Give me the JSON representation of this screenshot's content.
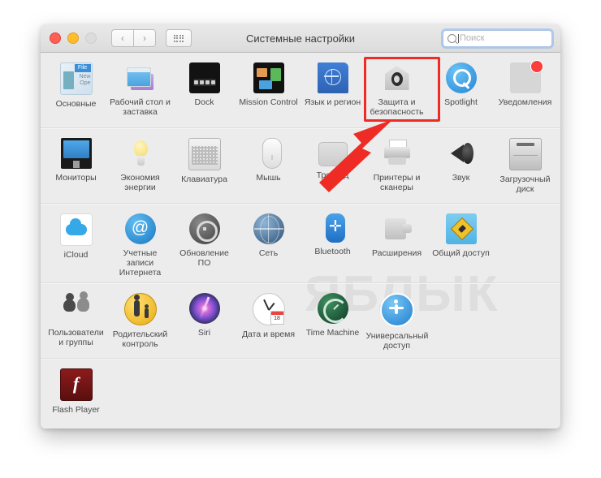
{
  "window": {
    "title": "Системные настройки",
    "traffic_lights": [
      "close-button",
      "minimize-button",
      "zoom-button"
    ],
    "nav": {
      "back": "‹",
      "forward": "›",
      "grid": "grid-view-icon"
    },
    "search": {
      "value": "",
      "placeholder": "Поиск"
    }
  },
  "watermark": "ЯБЛЫК",
  "highlight": {
    "color": "#ee2b24",
    "target": "Защита и безопасность"
  },
  "rows": [
    {
      "items": [
        {
          "label": "Основные",
          "icon": "general-icon",
          "icon_class": "i-general"
        },
        {
          "label": "Рабочий стол и заставка",
          "icon": "desktop-screensaver-icon",
          "icon_class": "i-desktop"
        },
        {
          "label": "Dock",
          "icon": "dock-icon",
          "icon_class": "i-dock"
        },
        {
          "label": "Mission Control",
          "icon": "mission-control-icon",
          "icon_class": "i-mission"
        },
        {
          "label": "Язык и регион",
          "icon": "language-region-icon",
          "icon_class": "i-lang"
        },
        {
          "label": "Защита и безопасность",
          "icon": "security-privacy-icon",
          "icon_class": "i-security"
        },
        {
          "label": "Spotlight",
          "icon": "spotlight-icon",
          "icon_class": "i-spotlight"
        },
        {
          "label": "Уведомления",
          "icon": "notifications-icon",
          "icon_class": "i-notif"
        }
      ]
    },
    {
      "items": [
        {
          "label": "Мониторы",
          "icon": "displays-icon",
          "icon_class": "i-display"
        },
        {
          "label": "Экономия энергии",
          "icon": "energy-saver-icon",
          "icon_class": "i-energy"
        },
        {
          "label": "Клавиатура",
          "icon": "keyboard-icon",
          "icon_class": "i-keyboard"
        },
        {
          "label": "Мышь",
          "icon": "mouse-icon",
          "icon_class": "i-mouse"
        },
        {
          "label": "Трекпад",
          "icon": "trackpad-icon",
          "icon_class": "i-trackpad"
        },
        {
          "label": "Принтеры и сканеры",
          "icon": "printers-scanners-icon",
          "icon_class": "i-printer"
        },
        {
          "label": "Звук",
          "icon": "sound-icon",
          "icon_class": "i-sound"
        },
        {
          "label": "Загрузочный диск",
          "icon": "startup-disk-icon",
          "icon_class": "i-disk"
        }
      ]
    },
    {
      "items": [
        {
          "label": "iCloud",
          "icon": "icloud-icon",
          "icon_class": "i-icloud"
        },
        {
          "label": "Учетные записи Интернета",
          "icon": "internet-accounts-icon",
          "icon_class": "i-inet"
        },
        {
          "label": "Обновление ПО",
          "icon": "software-update-icon",
          "icon_class": "i-update"
        },
        {
          "label": "Сеть",
          "icon": "network-icon",
          "icon_class": "i-network"
        },
        {
          "label": "Bluetooth",
          "icon": "bluetooth-icon",
          "icon_class": "i-bt"
        },
        {
          "label": "Расширения",
          "icon": "extensions-icon",
          "icon_class": "i-ext"
        },
        {
          "label": "Общий доступ",
          "icon": "sharing-icon",
          "icon_class": "i-share"
        }
      ]
    },
    {
      "items": [
        {
          "label": "Пользователи и группы",
          "icon": "users-groups-icon",
          "icon_class": "i-users"
        },
        {
          "label": "Родительский контроль",
          "icon": "parental-controls-icon",
          "icon_class": "i-parental"
        },
        {
          "label": "Siri",
          "icon": "siri-icon",
          "icon_class": "i-siri"
        },
        {
          "label": "Дата и время",
          "icon": "date-time-icon",
          "icon_class": "i-date"
        },
        {
          "label": "Time Machine",
          "icon": "time-machine-icon",
          "icon_class": "i-tm"
        },
        {
          "label": "Универсальный доступ",
          "icon": "accessibility-icon",
          "icon_class": "i-access"
        }
      ]
    },
    {
      "items": [
        {
          "label": "Flash Player",
          "icon": "flash-player-icon",
          "icon_class": "i-flash"
        }
      ]
    }
  ],
  "date_icon_day": "18"
}
